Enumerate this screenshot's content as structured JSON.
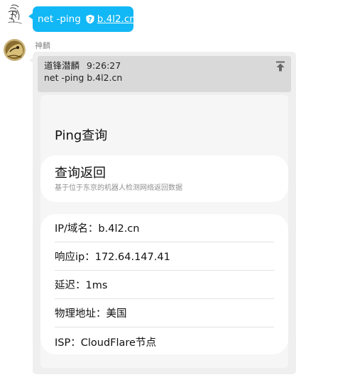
{
  "user_message": {
    "command": "net -ping",
    "link_text": "b.4l2.cn"
  },
  "bot": {
    "name": "神麟",
    "quote": {
      "author": "道锋潜麟",
      "time": "9:26:27",
      "text": "net -ping b.4l2.cn"
    },
    "card": {
      "title": "Ping查询",
      "section_title": "查询返回",
      "section_subtitle": "基于位于东京的机器人检测网络返回数据",
      "rows": [
        "IP/域名：b.4l2.cn",
        "响应ip：172.64.147.41",
        "延迟：1ms",
        "物理地址：美国",
        "ISP：CloudFlare节点"
      ]
    }
  },
  "colors": {
    "self_bubble": "#12b7f5",
    "bot_bubble": "#efefef",
    "quote_bg": "#d9d9d9"
  },
  "icons": {
    "link_badge": "shield-question-icon",
    "quote_action": "pin-to-top-icon"
  }
}
